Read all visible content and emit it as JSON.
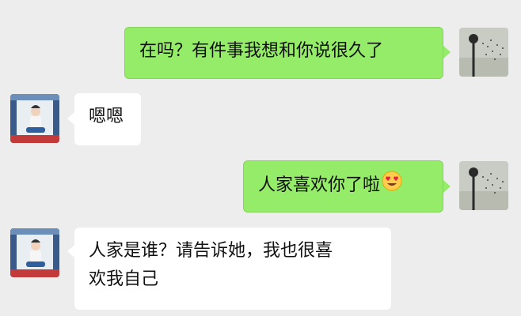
{
  "messages": [
    {
      "side": "right",
      "text": "在吗？有件事我想和你说很久了",
      "avatar": "dandelion-avatar"
    },
    {
      "side": "left",
      "text": "嗯嗯",
      "avatar": "boy-avatar"
    },
    {
      "side": "right",
      "text": "人家喜欢你了啦",
      "emoji": "heart-eyes-emoji",
      "avatar": "dandelion-avatar"
    },
    {
      "side": "left",
      "text_lines": [
        "人家是谁？请告诉她，我也很喜",
        "欢我自己"
      ],
      "avatar": "boy-avatar"
    }
  ],
  "colors": {
    "background": "#ededed",
    "sent_bubble": "#95ec69",
    "received_bubble": "#ffffff"
  }
}
